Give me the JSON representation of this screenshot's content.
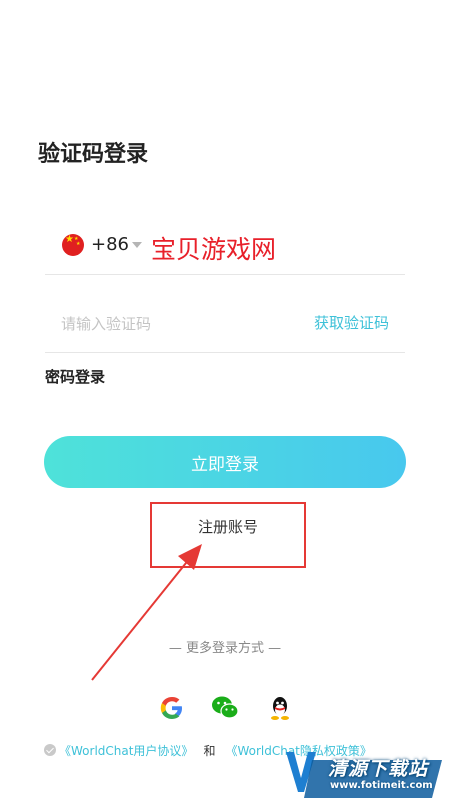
{
  "page": {
    "title": "验证码登录"
  },
  "phone": {
    "country_code": "+86",
    "overlay_watermark": "宝贝游戏网"
  },
  "verify": {
    "placeholder": "请输入验证码",
    "get_code_label": "获取验证码"
  },
  "password_login_label": "密码登录",
  "login_button_label": "立即登录",
  "register_label": "注册账号",
  "more_login_label": "— 更多登录方式 —",
  "social": [
    "google-icon",
    "wechat-icon",
    "qq-icon"
  ],
  "agreement": {
    "user_agreement": "《WorldChat用户协议》",
    "and": "和",
    "privacy_policy": "《WorldChat隐私权政策》"
  },
  "watermark": {
    "name": "清源下载站",
    "url": "www.fotimeit.com"
  },
  "colors": {
    "accent": "#3ec1d8",
    "button_start": "#4ee2d9",
    "button_end": "#48c8ee",
    "annotation": "#e53935"
  }
}
